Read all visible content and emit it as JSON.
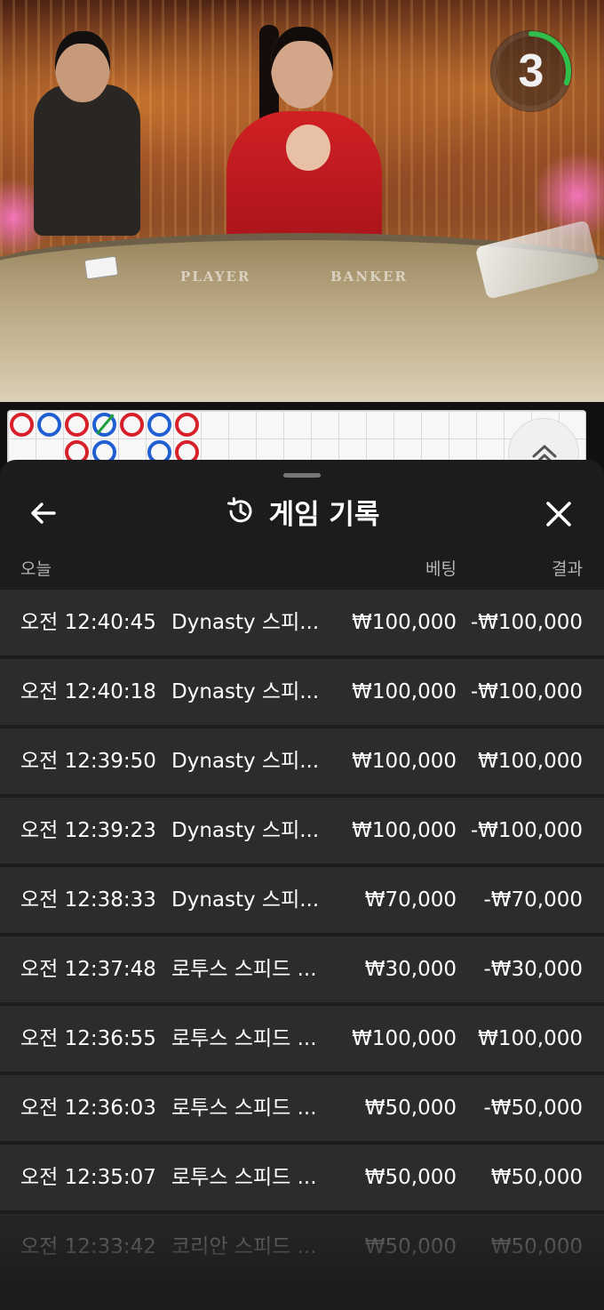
{
  "video": {
    "countdown": "3",
    "countdown_progress": 0.3,
    "table_labels": {
      "player": "PLAYER",
      "banker": "BANKER"
    }
  },
  "roadmap": {
    "beads": [
      {
        "col": 0,
        "row": 0,
        "side": "banker"
      },
      {
        "col": 1,
        "row": 0,
        "side": "player"
      },
      {
        "col": 2,
        "row": 0,
        "side": "banker"
      },
      {
        "col": 2,
        "row": 1,
        "side": "banker"
      },
      {
        "col": 3,
        "row": 0,
        "side": "player",
        "tie": true
      },
      {
        "col": 3,
        "row": 1,
        "side": "player"
      },
      {
        "col": 4,
        "row": 0,
        "side": "banker"
      },
      {
        "col": 5,
        "row": 0,
        "side": "player"
      },
      {
        "col": 5,
        "row": 1,
        "side": "player"
      },
      {
        "col": 6,
        "row": 0,
        "side": "banker"
      },
      {
        "col": 6,
        "row": 1,
        "side": "banker"
      }
    ],
    "colors": {
      "banker": "#d8202a",
      "player": "#1f5fd1",
      "tie": "#1f9d3a"
    }
  },
  "history": {
    "title": "게임 기록",
    "icons": {
      "back": "arrow-left-icon",
      "title": "history-icon",
      "close": "close-icon",
      "expand": "chevron-up-double-icon"
    },
    "columns": {
      "date": "오늘",
      "bet": "베팅",
      "result": "결과"
    },
    "rows": [
      {
        "time": "오전 12:40:45",
        "game": "Dynasty 스피...",
        "bet": "₩100,000",
        "result": "-₩100,000"
      },
      {
        "time": "오전 12:40:18",
        "game": "Dynasty 스피...",
        "bet": "₩100,000",
        "result": "-₩100,000"
      },
      {
        "time": "오전 12:39:50",
        "game": "Dynasty 스피...",
        "bet": "₩100,000",
        "result": "₩100,000"
      },
      {
        "time": "오전 12:39:23",
        "game": "Dynasty 스피...",
        "bet": "₩100,000",
        "result": "-₩100,000"
      },
      {
        "time": "오전 12:38:33",
        "game": "Dynasty 스피...",
        "bet": "₩70,000",
        "result": "-₩70,000"
      },
      {
        "time": "오전 12:37:48",
        "game": "로투스 스피드 ...",
        "bet": "₩30,000",
        "result": "-₩30,000"
      },
      {
        "time": "오전 12:36:55",
        "game": "로투스 스피드 ...",
        "bet": "₩100,000",
        "result": "₩100,000"
      },
      {
        "time": "오전 12:36:03",
        "game": "로투스 스피드 ...",
        "bet": "₩50,000",
        "result": "-₩50,000"
      },
      {
        "time": "오전 12:35:07",
        "game": "로투스 스피드 ...",
        "bet": "₩50,000",
        "result": "₩50,000"
      },
      {
        "time": "오전 12:33:42",
        "game": "코리안 스피드 ...",
        "bet": "₩50,000",
        "result": "₩50,000",
        "faded": true
      }
    ]
  }
}
